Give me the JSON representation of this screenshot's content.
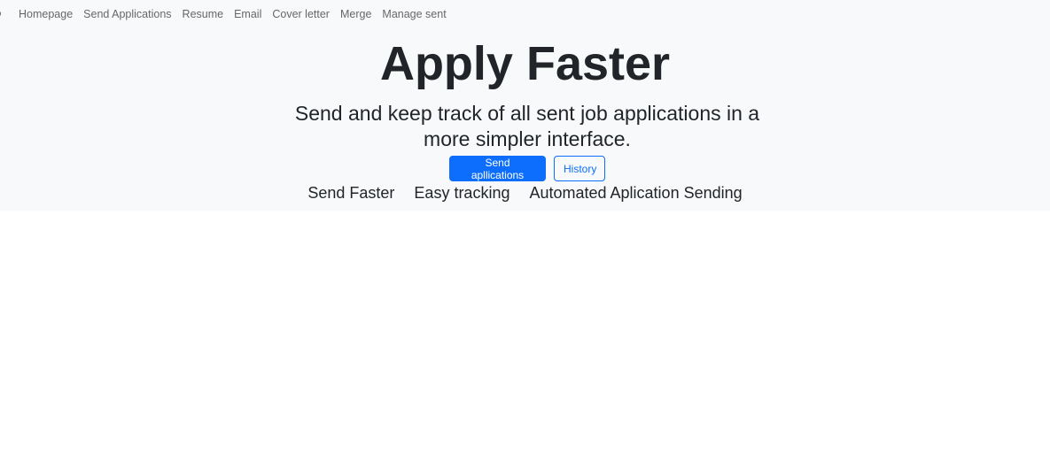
{
  "navbar": {
    "brand_fragment": "o",
    "items": [
      {
        "label": "Homepage"
      },
      {
        "label": "Send Applications"
      },
      {
        "label": "Resume"
      },
      {
        "label": "Email"
      },
      {
        "label": "Cover letter"
      },
      {
        "label": "Merge"
      },
      {
        "label": "Manage sent"
      }
    ]
  },
  "hero": {
    "title": "Apply Faster",
    "subtitle": "Send and keep track of all sent job applications in a more simpler interface.",
    "primary_button": "Send apllications",
    "secondary_button": "History",
    "features": [
      "Send Faster",
      "Easy tracking",
      "Automated Aplication Sending"
    ]
  },
  "colors": {
    "hero_background": "#f8f9fa",
    "primary": "#0d6efd",
    "text": "#212529"
  }
}
